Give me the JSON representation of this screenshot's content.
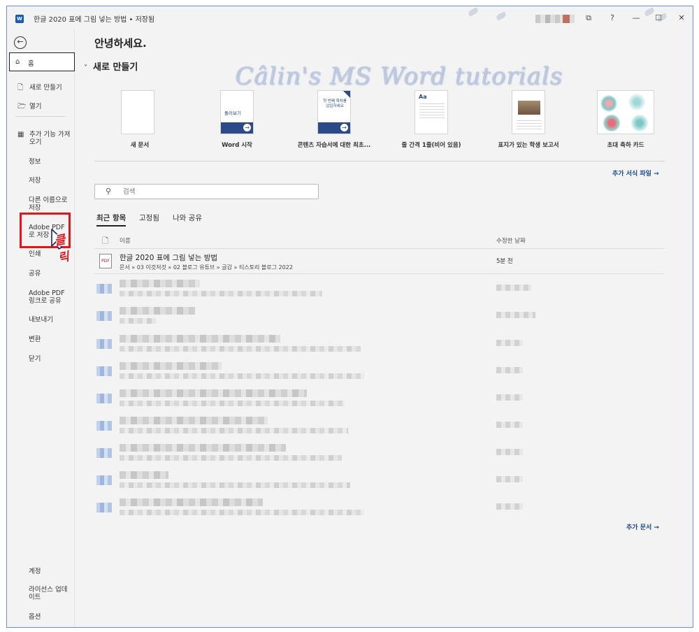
{
  "window": {
    "app_icon": "W",
    "title": "한글 2020 표에 그림 넣는 방법 • 저장됨",
    "minimize": "—",
    "maximize": "☐",
    "close": "✕",
    "help": "?",
    "feedback_icon": "⧉"
  },
  "sidebar": {
    "back_icon": "←",
    "home_icon": "⌂",
    "home": "홈",
    "new_icon": "🗋",
    "new": "새로 만들기",
    "open_icon": "🗁",
    "open": "열기",
    "addins_icon": "▦",
    "addins": "추가 기능 가져오기",
    "info": "정보",
    "save": "저장",
    "save_as": "다른 이름으로 저장",
    "adobe_pdf": "Adobe PDF로 저장",
    "print": "인쇄",
    "share": "공유",
    "adobe_link": "Adobe PDF 링크로 공유",
    "export": "내보내기",
    "transform": "변환",
    "close": "닫기",
    "account": "계정",
    "license": "라이선스 업데이트",
    "options": "옵션"
  },
  "annotation": {
    "click_label": "클릭"
  },
  "main": {
    "greeting": "안녕하세요.",
    "new_section": "새로 만들기",
    "new_chevron": "˅",
    "watermark": "Câlin's MS Word tutorials",
    "templates": [
      {
        "label": "새 문서"
      },
      {
        "label": "Word 시작",
        "thumb_text": "둘러보기"
      },
      {
        "label": "콘텐츠 자습서에 대한 최초...",
        "thumb_text": "첫 번째 목차를 삽입하세요"
      },
      {
        "label": "줄 간격 1줄(비어 있음)",
        "thumb_text": "Aa"
      },
      {
        "label": "표지가 있는 학생 보고서"
      },
      {
        "label": "초대 축하 카드"
      }
    ],
    "more_templates": "추가 서식 파일 →",
    "search": {
      "icon": "⚲",
      "placeholder": "검색"
    },
    "tabs": {
      "recent": "최근 항목",
      "pinned": "고정됨",
      "shared": "나와 공유"
    },
    "list_header": {
      "icon": "🗋",
      "name": "이름",
      "modified": "수정한 날짜"
    },
    "file": {
      "icon_label": "PDF",
      "name": "한글 2020 표에 그림 넣는 방법",
      "path": "문서 » 03 이것저것 » 02 블로그 유튜브 » 글감 » 티스토리 블로그 2022",
      "date": "5분 전"
    },
    "more_documents": "추가 문서 →"
  }
}
